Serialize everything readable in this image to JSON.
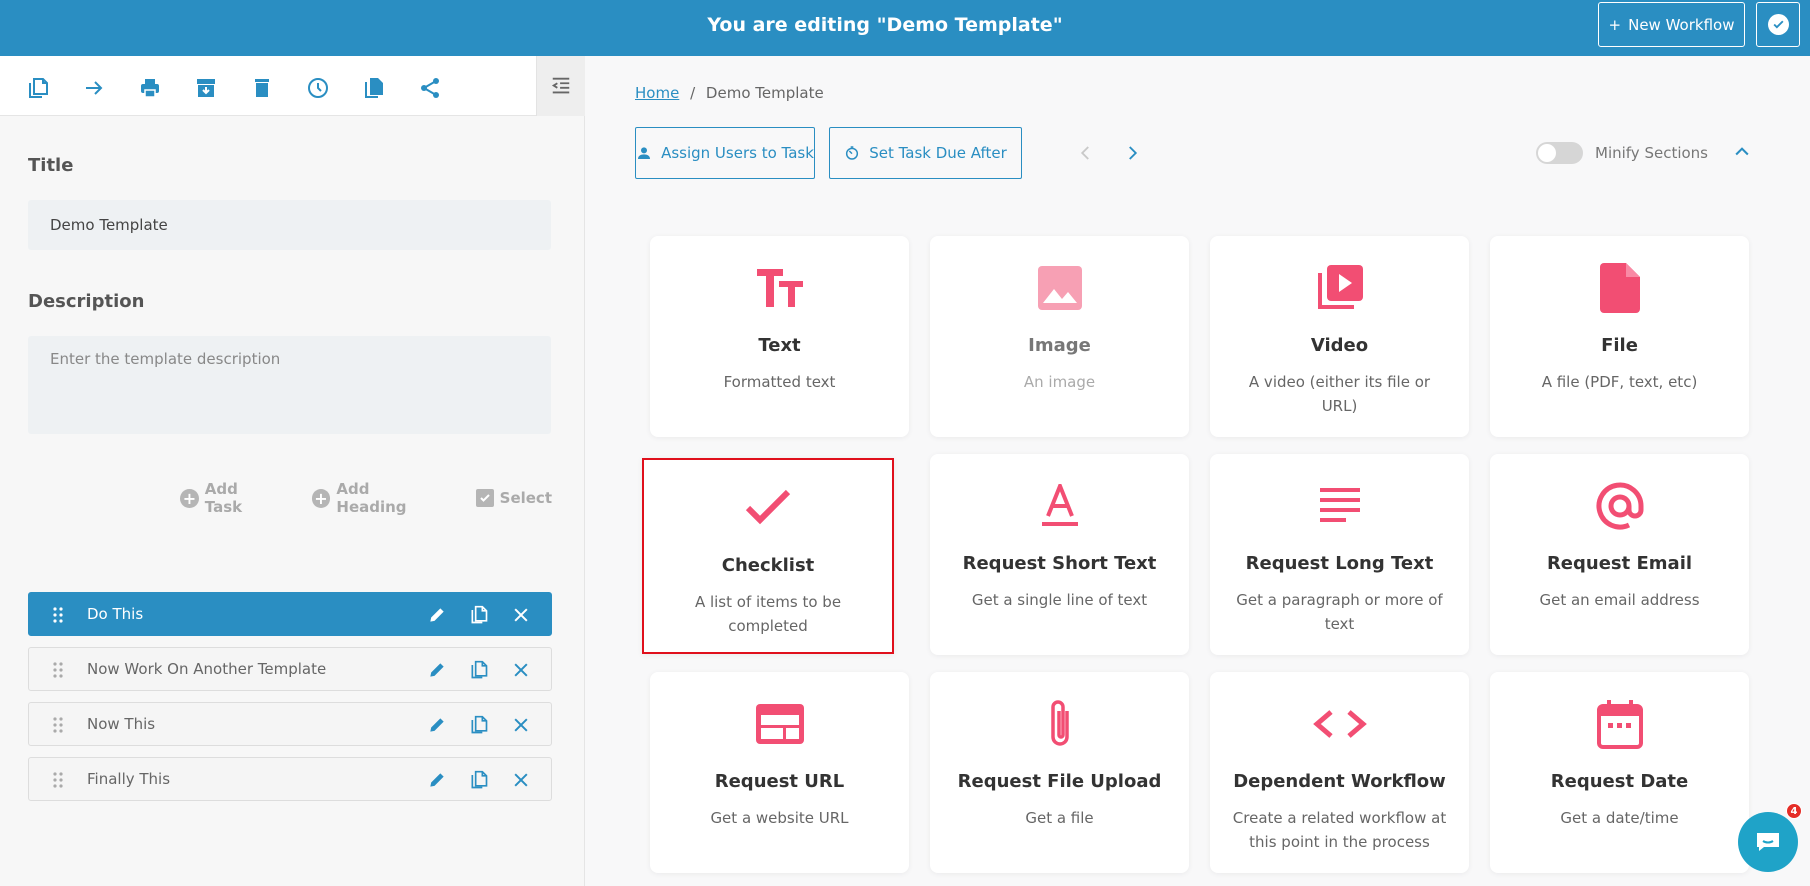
{
  "header": {
    "title": "You are editing \"Demo Template\"",
    "new_workflow_label": "New Workflow",
    "new_workflow_plus": "+"
  },
  "toolbar": {
    "icons": [
      "copy-icon",
      "arrow-right-icon",
      "print-icon",
      "archive-icon",
      "trash-icon",
      "clock-icon",
      "duplicate-icon",
      "share-icon",
      "collapse-panel-icon"
    ]
  },
  "left": {
    "title_label": "Title",
    "title_value": "Demo Template",
    "description_label": "Description",
    "description_placeholder": "Enter the template description",
    "add_task_label": "Add Task",
    "add_heading_label": "Add Heading",
    "select_label": "Select",
    "tasks": [
      {
        "name": "Do This",
        "active": true
      },
      {
        "name": "Now Work On Another Template",
        "active": false
      },
      {
        "name": "Now This",
        "active": false
      },
      {
        "name": "Finally This",
        "active": false
      }
    ]
  },
  "main": {
    "breadcrumb_home": "Home",
    "breadcrumb_sep": "/",
    "breadcrumb_current": "Demo Template",
    "assign_users_label": "Assign Users to Task",
    "set_due_label": "Set Task Due After",
    "minify_label": "Minify Sections",
    "minify_on": false
  },
  "cards": [
    {
      "title": "Text",
      "desc": "Formatted text",
      "icon": "text-format-icon"
    },
    {
      "title": "Image",
      "desc": "An image",
      "icon": "image-icon"
    },
    {
      "title": "Video",
      "desc": "A video (either its file or URL)",
      "icon": "video-library-icon"
    },
    {
      "title": "File",
      "desc": "A file (PDF, text, etc)",
      "icon": "file-icon"
    },
    {
      "title": "Checklist",
      "desc": "A list of items to be completed",
      "icon": "check-icon"
    },
    {
      "title": "Request Short Text",
      "desc": "Get a single line of text",
      "icon": "short-text-icon"
    },
    {
      "title": "Request Long Text",
      "desc": "Get a paragraph or more of text",
      "icon": "long-text-icon"
    },
    {
      "title": "Request Email",
      "desc": "Get an email address",
      "icon": "at-sign-icon"
    },
    {
      "title": "Request URL",
      "desc": "Get a website URL",
      "icon": "web-icon"
    },
    {
      "title": "Request File Upload",
      "desc": "Get a file",
      "icon": "paperclip-icon"
    },
    {
      "title": "Dependent Workflow",
      "desc": "Create a related workflow at this point in the process",
      "icon": "code-icon"
    },
    {
      "title": "Request Date",
      "desc": "Get a date/time",
      "icon": "calendar-icon"
    }
  ],
  "chat": {
    "badge_count": "4"
  },
  "colors": {
    "primary": "#2a8ec2",
    "accent": "#f24e73",
    "selected_border": "#e0101c"
  }
}
